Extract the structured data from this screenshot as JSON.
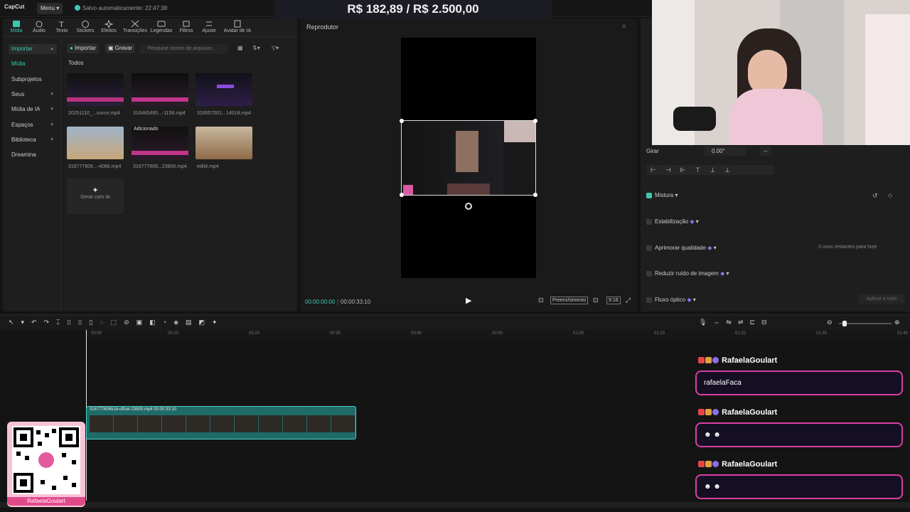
{
  "topbar": {
    "logo": "CapCut",
    "menu": "Menu",
    "autosave": "Salvo automaticamente: 22:47:38",
    "goal": "R$ 182,89 / R$ 2.500,00"
  },
  "media": {
    "tabs": [
      {
        "label": "Mídia",
        "icon": "media-icon"
      },
      {
        "label": "Áudio",
        "icon": "audio-icon"
      },
      {
        "label": "Texto",
        "icon": "text-icon"
      },
      {
        "label": "Stickers",
        "icon": "sticker-icon"
      },
      {
        "label": "Efeitos",
        "icon": "effects-icon"
      },
      {
        "label": "Transições",
        "icon": "transition-icon"
      },
      {
        "label": "Legendas",
        "icon": "captions-icon"
      },
      {
        "label": "Filtros",
        "icon": "filter-icon"
      },
      {
        "label": "Ajuste",
        "icon": "adjust-icon"
      },
      {
        "label": "Avatar de IA",
        "icon": "avatar-icon"
      }
    ],
    "sidebar": [
      {
        "label": "Importar"
      },
      {
        "label": "Mídia"
      },
      {
        "label": "Subprojetos"
      },
      {
        "label": "Seus"
      },
      {
        "label": "Mídia de IA"
      },
      {
        "label": "Espaços"
      },
      {
        "label": "Biblioteca"
      },
      {
        "label": "Dreamina"
      }
    ],
    "import_btn": "Importar",
    "record_btn": "Gravar",
    "search_placeholder": "Pesquise nomes de arquivos...",
    "section": "Todos",
    "items": [
      {
        "label": "20251110_...ource.mp4"
      },
      {
        "label": "316465495...-1158.mp4"
      },
      {
        "label": "316557001...14018.mp4"
      },
      {
        "label": "316777606...-4066.mp4"
      },
      {
        "label": "316777606...23800.mp4",
        "badge": "Adicionado"
      },
      {
        "label": "edit4.mp4"
      }
    ],
    "ai_generate": "Gerar com IA"
  },
  "player": {
    "title": "Reprodutor",
    "current_time": "00:00:00:00",
    "total_time": "00:00:33:10",
    "fill": "Preenchimento",
    "ratio": "9:16"
  },
  "props": {
    "rotate_label": "Girar",
    "rotate_value": "0.00°",
    "mix": "Mistura",
    "stabilize": "Estabilização",
    "enhance": "Aprimorar qualidade",
    "enhance_note": "3 usos restantes para hoje",
    "denoise": "Reduzir ruído de imagem",
    "optical": "Fluxo óptico",
    "apply_all": "Aplicar a todo"
  },
  "timeline": {
    "ticks": [
      "00:00",
      "00:10",
      "00:20",
      "00:30",
      "00:40",
      "00:50",
      "01:00",
      "01:10",
      "01:20",
      "01:30",
      "01:40"
    ],
    "clip_label": "316777606516-offset-23800.mp4   00:00:33:10"
  },
  "overlay": {
    "qr_name": "RafaelaGoulart",
    "chat": [
      {
        "user": "RafaelaGoulart",
        "message": "rafaelaFaca"
      },
      {
        "user": "RafaelaGoulart",
        "message": "☻ ☻"
      },
      {
        "user": "RafaelaGoulart",
        "message": "☻ ☻"
      }
    ]
  },
  "colors": {
    "accent": "#3ec7b0",
    "chat_border": "#d93fa2",
    "clip": "#1f6b68"
  }
}
